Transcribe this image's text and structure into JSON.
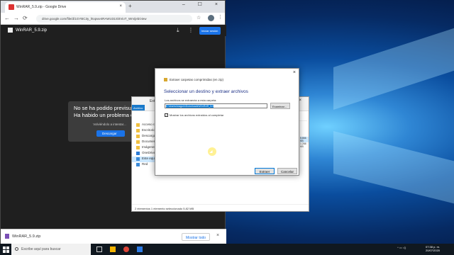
{
  "browser": {
    "tab_title": "WinRAR_5.9.zip - Google Drive",
    "tab_close": "×",
    "new_tab": "+",
    "window_controls": "– ☐ ×",
    "nav_back": "←",
    "nav_forward": "→",
    "nav_reload": "⟳",
    "lock": "🔒",
    "url": "drive.google.com/file/d/1GYBC3y_htxpwv4RAWU31Sl4VioT_Wm/jeb/view",
    "star": "☆",
    "kebab": "⋮"
  },
  "viewer": {
    "file_name": "WinRAR_5.9.zip",
    "download_icon": "⤓",
    "more_icon": "⋮",
    "open_with": "Iniciar sesión"
  },
  "error": {
    "line1": "No se ha podido previsualiz",
    "line2": "Ha habido un problema con la",
    "retry": "Volviéndolo a intentar...",
    "download": "Descargar"
  },
  "download_bar": {
    "item": "WinRAR_5.9.zip",
    "show_all": "Mostrar todo",
    "close": "×"
  },
  "explorer": {
    "title": "Extraer",
    "tab_archive": "Archivo",
    "window_controls": "– ☐ ×",
    "nav_items": [
      "Acceso ráp",
      "Escritorio",
      "Descargas",
      "Documentos",
      "Imágenes",
      "OneDrive",
      "Este equipo",
      "Red"
    ],
    "file_sizes": [
      "5.866 KB",
      "1.266 KB"
    ],
    "status": "2 elementos    1 elemento seleccionado 5,82 MB"
  },
  "dialog": {
    "close": "×",
    "header": "Extraer carpetas comprimidas (en zip)",
    "title": "Seleccionar un destino y extraer archivos",
    "dest_label": "Los archivos se extraerán a esta carpeta:",
    "dest_value": "C:\\Users\\maguin\\Downloads\\WinRAR_5.9",
    "browse": "Examinar...",
    "checkbox_mark": "✓",
    "show_label": "Mostrar los archivos extraídos al completar",
    "extract": "Extraer",
    "cancel": "Cancelar"
  },
  "taskbar": {
    "search_placeholder": "Escribe aquí para buscar",
    "tray": "^ ▭ ◁)",
    "time": "07:38 p. m.",
    "date": "20/07/2020"
  }
}
